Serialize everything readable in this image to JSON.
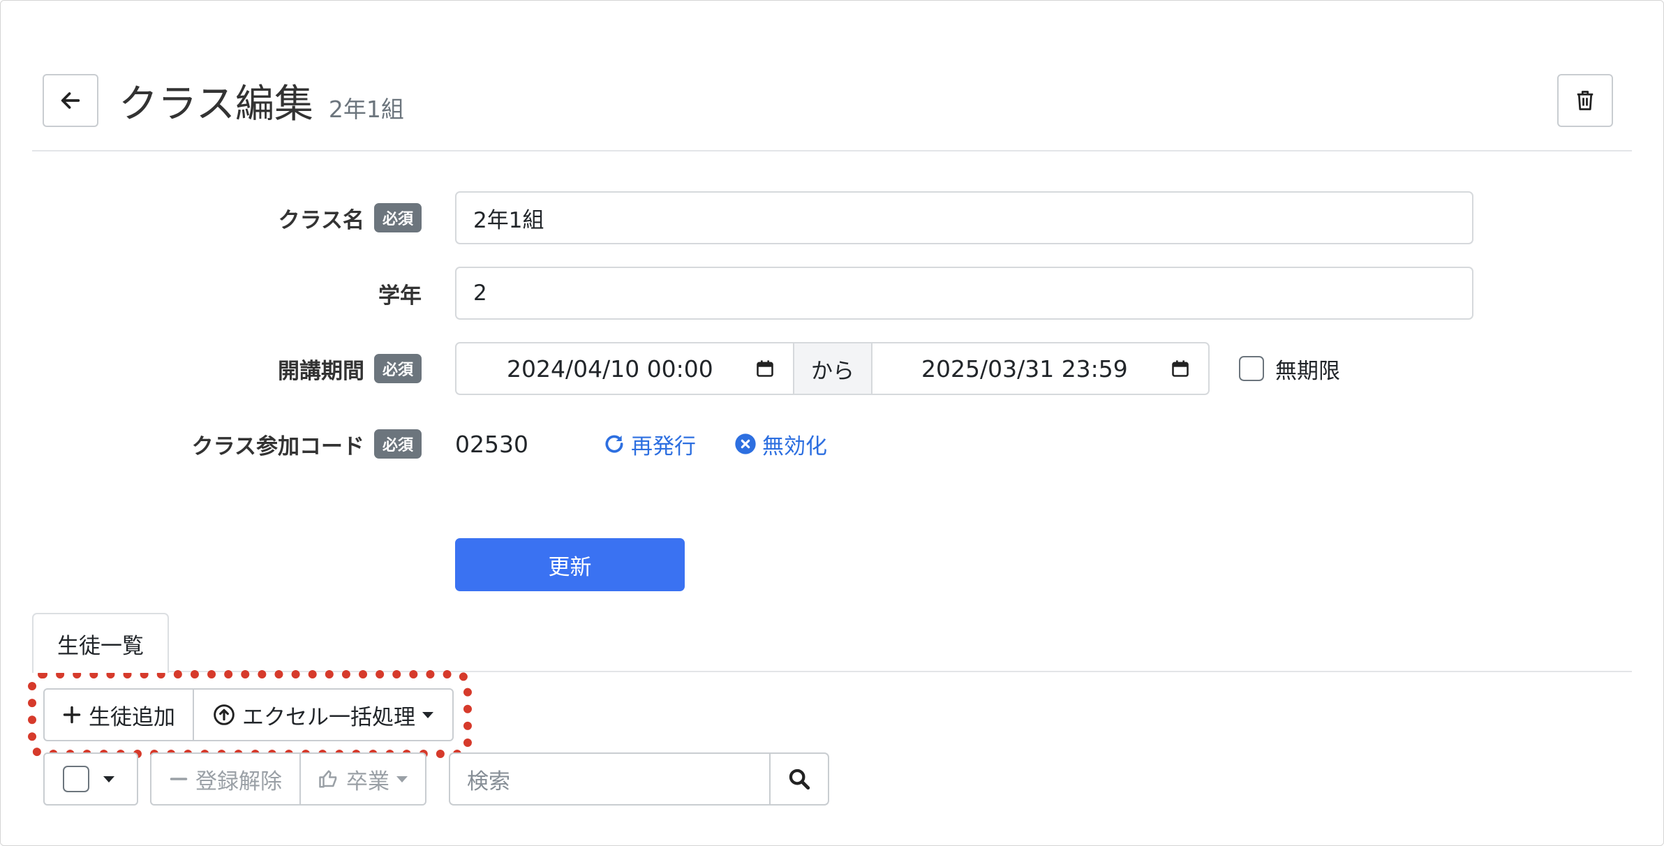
{
  "header": {
    "title": "クラス編集",
    "subtitle": "2年1組"
  },
  "form": {
    "required_badge": "必須",
    "class_name": {
      "label": "クラス名",
      "value": "2年1組"
    },
    "grade": {
      "label": "学年",
      "value": "2"
    },
    "period": {
      "label": "開講期間",
      "start": "2024/04/10 00:00",
      "separator": "から",
      "end": "2025/03/31 23:59",
      "unlimited_label": "無期限"
    },
    "join_code": {
      "label": "クラス参加コード",
      "value": "02530",
      "reissue_label": "再発行",
      "disable_label": "無効化"
    },
    "submit_label": "更新"
  },
  "tabs": [
    {
      "label": "生徒一覧"
    }
  ],
  "toolbar": {
    "add_student_label": "生徒追加",
    "excel_label": "エクセル一括処理"
  },
  "bulk": {
    "unregister_label": "登録解除",
    "graduate_label": "卒業",
    "search_placeholder": "検索"
  },
  "colors": {
    "primary": "#3a72f2",
    "link": "#2d6fe0",
    "highlight": "#d63a2b",
    "badge": "#6c757d"
  }
}
